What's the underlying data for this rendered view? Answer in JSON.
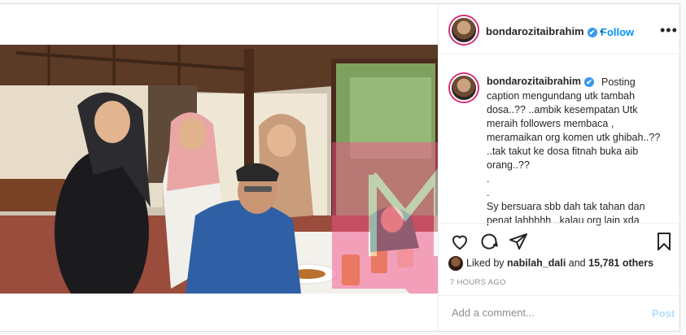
{
  "header": {
    "username": "bondarozitaibrahim",
    "verified_mark": "✔",
    "separator": "•",
    "follow_label": "Follow",
    "more_label": "•••"
  },
  "caption": {
    "username": "bondarozitaibrahim",
    "text": "Posting caption mengundang utk tambah dosa..?? ..ambik kesempatan Utk meraih followers membaca , meramaikan org komen utk ghibah..?? ..tak takut ke dosa fitnah buka aib orang..??\n.\n.\nSy bersuara sbb dah tak tahan dan penat lahhhhh ..kalau org lain xda"
  },
  "actions": {
    "icons": [
      "heart-icon",
      "comment-icon",
      "share-icon",
      "bookmark-icon"
    ]
  },
  "likes": {
    "prefix": "Liked by",
    "user": "nabilah_dali",
    "joiner": "and",
    "count": "15,781 others"
  },
  "timestamp": "7 HOURS AGO",
  "comment_box": {
    "placeholder": "Add a comment...",
    "post_label": "Post"
  },
  "carousel": {
    "total": 3,
    "active_index": 0
  },
  "colors": {
    "link_blue": "#0095f6",
    "verified_blue": "#3897f0",
    "text": "#262626",
    "muted": "#8e8e8e",
    "watermark_pink": "#f2508a"
  }
}
